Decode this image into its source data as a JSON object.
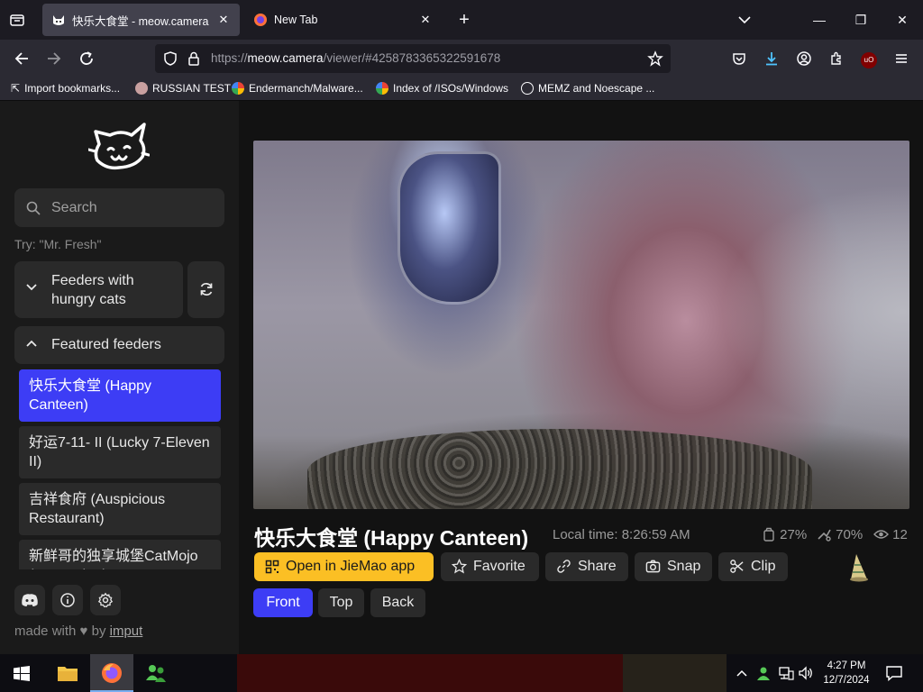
{
  "browser": {
    "tabs": [
      {
        "title": "快乐大食堂 - meow.camera",
        "active": true
      },
      {
        "title": "New Tab",
        "active": false
      }
    ],
    "url_prefix": "https://",
    "url_host": "meow.camera",
    "url_path": "/viewer/#4258783365322591678",
    "bookmarks": [
      {
        "label": "Import bookmarks..."
      },
      {
        "label": "RUSSIAN TEST"
      },
      {
        "label": "Endermanch/Malware..."
      },
      {
        "label": "Index of /ISOs/Windows"
      },
      {
        "label": "MEMZ and Noescape ..."
      }
    ],
    "ublock_badge": "uO"
  },
  "sidebar": {
    "search_placeholder": "Search",
    "hint": "Try: \"Mr. Fresh\"",
    "group_hungry": "Feeders with hungry cats",
    "group_featured": "Featured feeders",
    "feeders": [
      {
        "label": "快乐大食堂 (Happy Canteen)",
        "selected": true
      },
      {
        "label": "好运7-11- II  (Lucky 7-Eleven II)",
        "selected": false
      },
      {
        "label": "吉祥食府 (Auspicious Restaurant)",
        "selected": false
      },
      {
        "label": "新鲜哥的独享城堡CatMojo (Mr.Fresh...)",
        "selected": false
      }
    ],
    "footer_made": "made with",
    "footer_by": "by",
    "footer_link": "imput"
  },
  "viewer": {
    "title": "快乐大食堂 (Happy Canteen)",
    "local_time": "Local time: 8:26:59 AM",
    "food_level": "27%",
    "health": "70%",
    "viewers": "12",
    "buttons": {
      "open_app": "Open in JieMao app",
      "favorite": "Favorite",
      "share": "Share",
      "snap": "Snap",
      "clip": "Clip"
    },
    "views": [
      "Front",
      "Top",
      "Back"
    ],
    "active_view": "Front"
  },
  "taskbar": {
    "time": "4:27 PM",
    "date": "12/7/2024"
  },
  "colors": {
    "accent": "#3d3df5",
    "app_button": "#fbbf24"
  }
}
